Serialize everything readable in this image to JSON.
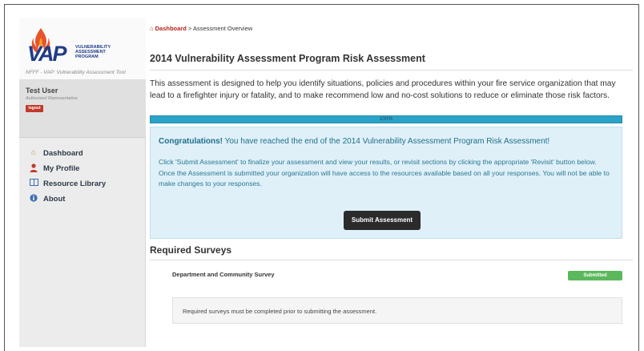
{
  "logo": {
    "mark": "VAP",
    "line1": "VULNERABILITY",
    "line2": "ASSESSMENT",
    "line3": "PROGRAM",
    "tagline": "NFFF - VAP: Vulnerability Assessment Tool"
  },
  "user": {
    "name": "Test User",
    "role": "Authorized Representative",
    "logout_label": "logout"
  },
  "nav": {
    "items": [
      {
        "label": "Dashboard",
        "icon": "home-icon"
      },
      {
        "label": "My Profile",
        "icon": "user-icon"
      },
      {
        "label": "Resource Library",
        "icon": "book-icon"
      },
      {
        "label": "About",
        "icon": "info-icon"
      }
    ]
  },
  "breadcrumb": {
    "home": "Dashboard",
    "separator": ">",
    "current": "Assessment Overview"
  },
  "page": {
    "title": "2014 Vulnerability Assessment Program Risk Assessment",
    "intro": "This assessment is designed to help you identify situations, policies and procedures within your fire service organization that may lead to a firefighter injury or fatality, and to make recommend low and no-cost solutions to reduce or eliminate those risk factors."
  },
  "progress": {
    "value": 100,
    "label": "100%"
  },
  "alert": {
    "heading_bold": "Congratulations!",
    "heading_rest": " You have reached the end of the 2014 Vulnerability Assessment Program Risk Assessment!",
    "line1": "Click 'Submit Assessment' to finalize your assessment and view your results, or revisit sections by clicking the appropriate 'Revisit' button below.",
    "line2": "Once the Assessment is submitted your organization will have access to the resources available based on all your responses. You will not be able to make changes to your responses.",
    "submit_label": "Submit Assessment"
  },
  "required": {
    "title": "Required Surveys",
    "survey_name": "Department and Community Survey",
    "status": "Submitted",
    "note": "Required surveys must be completed prior to submitting the assessment."
  },
  "colors": {
    "brand_blue": "#1f3c88",
    "link_red": "#b42318",
    "progress": "#2aa3c9",
    "success": "#5cb85c"
  }
}
